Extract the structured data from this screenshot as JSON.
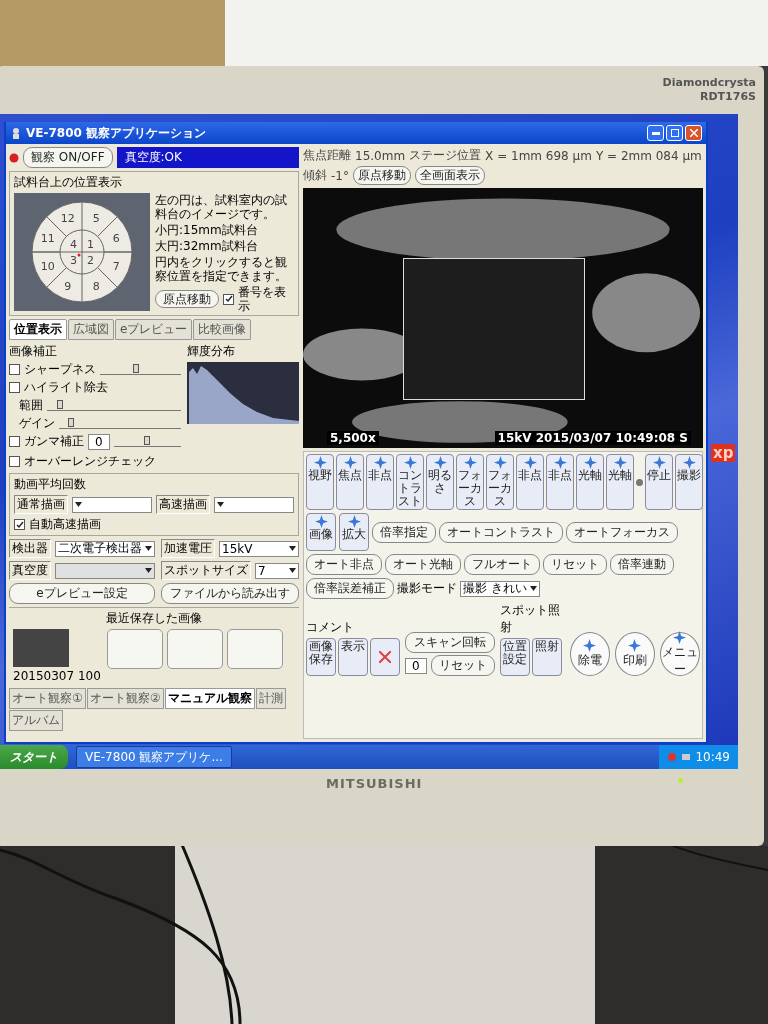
{
  "monitor": {
    "model_line1": "Diamondcrysta",
    "model_line2": "RDT176S",
    "brand": "MITSUBISHI",
    "power_on": true
  },
  "window": {
    "title": "VE-7800 観察アプリケーション"
  },
  "toolbar": {
    "observe_button": "観察 ON/OFF",
    "vacuum_status": "真空度:OK"
  },
  "position_panel": {
    "title": "試料台上の位置表示",
    "outer_numbers": [
      "12",
      "5",
      "11",
      "6",
      "10",
      "7",
      "9",
      "8"
    ],
    "inner_numbers": [
      "4",
      "1",
      "3",
      "2"
    ],
    "notes": [
      "左の円は、試料室内の試料台のイメージです。",
      "小円:15mm試料台",
      "大円:32mm試料台",
      "円内をクリックすると観察位置を指定できます。"
    ],
    "origin_button": "原点移動",
    "show_numbers": {
      "label": "番号を表示",
      "checked": true
    }
  },
  "tabs": [
    {
      "label": "位置表示",
      "selected": true
    },
    {
      "label": "広域図",
      "selected": false
    },
    {
      "label": "eプレビュー",
      "selected": false
    },
    {
      "label": "比較画像",
      "selected": false
    }
  ],
  "image_correction": {
    "title": "画像補正",
    "sharpness": {
      "label": "シャープネス",
      "checked": false,
      "level": 0.45
    },
    "highlight": {
      "label": "ハイライト除去",
      "checked": false,
      "range": {
        "label": "範囲",
        "level": 0.1
      },
      "gain": {
        "label": "ゲイン",
        "level": 0.1
      }
    },
    "gamma": {
      "label": "ガンマ補正",
      "checked": false,
      "value": "0",
      "level": 0.5
    },
    "histogram_title": "輝度分布",
    "overrange": {
      "label": "オーバーレンジチェック",
      "checked": false
    }
  },
  "averaging": {
    "title": "動画平均回数",
    "normal_label": "通常描画",
    "fast_label": "高速描画",
    "auto_fast": {
      "label": "自動高速描画",
      "checked": true
    }
  },
  "settings": [
    {
      "label": "検出器",
      "value": "二次電子検出器",
      "disabled": false
    },
    {
      "label": "加速電圧",
      "value": "15kV",
      "disabled": false
    },
    {
      "label": "真空度",
      "disabled": true
    },
    {
      "label": "スポットサイズ",
      "value": "7",
      "disabled": false
    }
  ],
  "panel_buttons": [
    "eプレビュー設定",
    "ファイルから読み出す"
  ],
  "recent_images": {
    "title": "最近保存した画像",
    "slots": [
      {
        "kind": "image",
        "caption": "20150307 100"
      },
      {
        "kind": "empty"
      },
      {
        "kind": "empty"
      },
      {
        "kind": "empty"
      }
    ]
  },
  "mode_tabs": [
    {
      "label": "オート観察①",
      "selected": false
    },
    {
      "label": "オート観察②",
      "selected": false
    },
    {
      "label": "マニュアル観察",
      "selected": true
    },
    {
      "label": "計測",
      "selected": false
    },
    {
      "label": "アルバム",
      "selected": false
    }
  ],
  "info_bar": {
    "focal_label": "焦点距離",
    "focal_value": "15.0mm",
    "stage_label": "ステージ位置",
    "x": "X = 1mm 698 μm",
    "y": "Y = 2mm 084 μm",
    "tilt_label": "傾斜",
    "tilt_value": "-1°",
    "buttons": [
      "原点移動",
      "全画面表示"
    ]
  },
  "micrograph": {
    "magnification": "5,500x",
    "caption": "15kV 2015/03/07 10:49:08 S"
  },
  "controls": {
    "icon_buttons": [
      {
        "label": "視野"
      },
      {
        "label": "焦点"
      },
      {
        "label": "非点"
      },
      {
        "label": "コントラスト"
      },
      {
        "label": "明るさ"
      },
      {
        "label": "フォーカス"
      },
      {
        "label": "フォーカス"
      },
      {
        "label": "非点"
      },
      {
        "label": "非点"
      },
      {
        "label": "光軸"
      },
      {
        "label": "光軸"
      },
      {
        "label": "停止"
      },
      {
        "label": "撮影"
      }
    ],
    "icon_buttons_row2": [
      {
        "label": "画像"
      },
      {
        "label": "拡大"
      }
    ],
    "pill_buttons": [
      "倍率指定",
      "オートコントラスト",
      "オートフォーカス",
      "オート非点",
      "オート光軸",
      "フルオート",
      "リセット",
      "倍率連動",
      "倍率誤差補正"
    ],
    "shooting_mode": {
      "label": "撮影モード",
      "value": "撮影 きれい"
    },
    "comment": {
      "title": "コメント",
      "buttons": [
        "画像保存",
        "表示"
      ]
    },
    "scan_rotation": {
      "button": "スキャン回転",
      "value": "0",
      "reset": "リセット"
    },
    "spot": {
      "title": "スポット照射",
      "buttons": [
        "位置設定",
        "照射"
      ]
    },
    "round_buttons": [
      "除電",
      "印刷",
      "メニュー"
    ]
  },
  "desktop_logo": "xp",
  "taskbar": {
    "start": "スタート",
    "task": "VE-7800 観察アプリケ...",
    "clock": "10:49"
  }
}
